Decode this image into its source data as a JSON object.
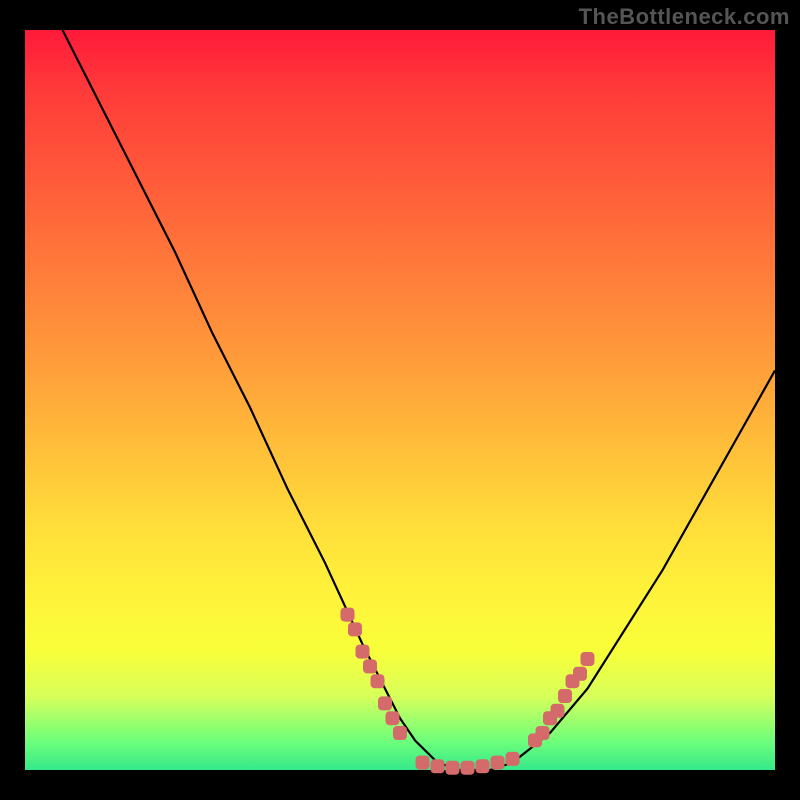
{
  "watermark": "TheBottleneck.com",
  "chart_data": {
    "type": "line",
    "title": "",
    "xlabel": "",
    "ylabel": "",
    "xlim": [
      0,
      100
    ],
    "ylim": [
      0,
      100
    ],
    "background_gradient": {
      "top": "#ff1a3a",
      "bottom": "#35e98a"
    },
    "series": [
      {
        "name": "curve",
        "x": [
          5,
          10,
          15,
          20,
          25,
          30,
          35,
          40,
          45,
          48,
          50,
          52,
          55,
          58,
          60,
          62,
          65,
          70,
          75,
          80,
          85,
          90,
          95,
          100
        ],
        "y": [
          100,
          90,
          80,
          70,
          59,
          49,
          38,
          28,
          17,
          11,
          7,
          4,
          1,
          0,
          0,
          0,
          1,
          5,
          11,
          19,
          27,
          36,
          45,
          54
        ]
      }
    ],
    "markers": {
      "left_cluster": [
        [
          43,
          21
        ],
        [
          44,
          19
        ],
        [
          45,
          16
        ],
        [
          46,
          14
        ],
        [
          47,
          12
        ],
        [
          48,
          9
        ],
        [
          49,
          7
        ],
        [
          50,
          5
        ]
      ],
      "bottom_cluster": [
        [
          53,
          1
        ],
        [
          55,
          0.5
        ],
        [
          57,
          0.3
        ],
        [
          59,
          0.3
        ],
        [
          61,
          0.5
        ],
        [
          63,
          1
        ],
        [
          65,
          1.5
        ]
      ],
      "right_cluster": [
        [
          68,
          4
        ],
        [
          69,
          5
        ],
        [
          70,
          7
        ],
        [
          71,
          8
        ],
        [
          72,
          10
        ],
        [
          73,
          12
        ],
        [
          74,
          13
        ],
        [
          75,
          15
        ]
      ]
    }
  }
}
